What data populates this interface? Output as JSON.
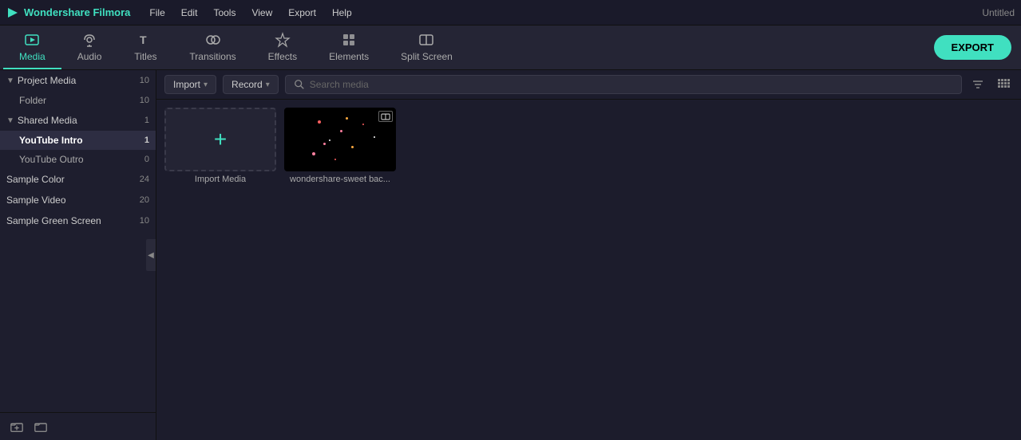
{
  "titlebar": {
    "app_name": "Wondershare Filmora",
    "menu_items": [
      "File",
      "Edit",
      "Tools",
      "View",
      "Export",
      "Help"
    ],
    "window_title": "Untitled"
  },
  "toolbar": {
    "tabs": [
      {
        "id": "media",
        "label": "Media",
        "active": true
      },
      {
        "id": "audio",
        "label": "Audio",
        "active": false
      },
      {
        "id": "titles",
        "label": "Titles",
        "active": false
      },
      {
        "id": "transitions",
        "label": "Transitions",
        "active": false
      },
      {
        "id": "effects",
        "label": "Effects",
        "active": false
      },
      {
        "id": "elements",
        "label": "Elements",
        "active": false
      },
      {
        "id": "split-screen",
        "label": "Split Screen",
        "active": false
      }
    ],
    "export_label": "EXPORT"
  },
  "sidebar": {
    "sections": [
      {
        "id": "project-media",
        "label": "Project Media",
        "count": "10",
        "expanded": true,
        "items": [
          {
            "id": "folder",
            "label": "Folder",
            "count": "10",
            "active": false
          }
        ]
      },
      {
        "id": "shared-media",
        "label": "Shared Media",
        "count": "1",
        "expanded": true,
        "items": [
          {
            "id": "youtube-intro",
            "label": "YouTube Intro",
            "count": "1",
            "active": true
          },
          {
            "id": "youtube-outro",
            "label": "YouTube Outro",
            "count": "0",
            "active": false
          }
        ]
      },
      {
        "id": "sample-color",
        "label": "Sample Color",
        "count": "24",
        "expanded": false,
        "items": []
      },
      {
        "id": "sample-video",
        "label": "Sample Video",
        "count": "20",
        "expanded": false,
        "items": []
      },
      {
        "id": "sample-green-screen",
        "label": "Sample Green Screen",
        "count": "10",
        "expanded": false,
        "items": []
      }
    ],
    "bottom_icons": [
      "new-folder-icon",
      "folder-icon"
    ]
  },
  "content": {
    "import_dropdown": "Import",
    "record_dropdown": "Record",
    "search_placeholder": "Search media",
    "media_items": [
      {
        "id": "import-media",
        "type": "import",
        "label": "Import Media"
      },
      {
        "id": "wondershare-sweet-bac",
        "type": "video",
        "label": "wondershare-sweet bac..."
      }
    ]
  },
  "colors": {
    "accent": "#40e0c0",
    "bg_dark": "#1c1c2c",
    "bg_sidebar": "#1e1e2e",
    "bg_toolbar": "#252535"
  }
}
